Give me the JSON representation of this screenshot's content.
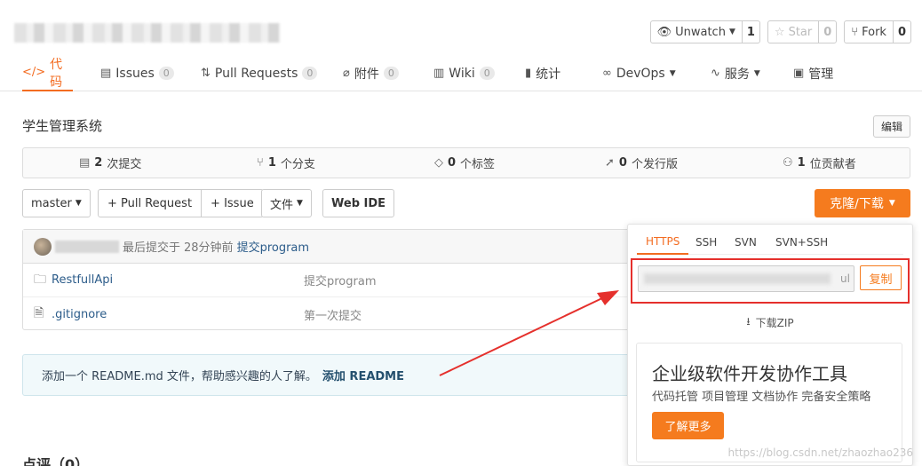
{
  "header": {
    "unwatch_label": "Unwatch",
    "unwatch_count": "1",
    "star_label": "Star",
    "star_count": "0",
    "fork_label": "Fork",
    "fork_count": "0"
  },
  "tabs": [
    {
      "label": "代码",
      "icon": "code-icon"
    },
    {
      "label": "Issues",
      "badge": "0",
      "icon": "issues-icon"
    },
    {
      "label": "Pull Requests",
      "badge": "0",
      "icon": "pull-request-icon"
    },
    {
      "label": "附件",
      "badge": "0",
      "icon": "attachment-icon"
    },
    {
      "label": "Wiki",
      "badge": "0",
      "icon": "wiki-icon"
    },
    {
      "label": "统计",
      "icon": "stats-icon"
    },
    {
      "label": "DevOps",
      "icon": "devops-icon"
    },
    {
      "label": "服务",
      "icon": "service-icon"
    },
    {
      "label": "管理",
      "icon": "manage-icon"
    }
  ],
  "project": {
    "description": "学生管理系统",
    "edit_label": "编辑"
  },
  "stats": {
    "commits_num": "2",
    "commits_label": "次提交",
    "branches_num": "1",
    "branches_label": "个分支",
    "tags_num": "0",
    "tags_label": "个标签",
    "releases_num": "0",
    "releases_label": "个发行版",
    "contributors_num": "1",
    "contributors_label": "位贡献者"
  },
  "toolbar": {
    "branch": "master",
    "pull_request": "+ Pull Request",
    "issue": "+ Issue",
    "file": "文件",
    "web_ide": "Web IDE",
    "clone": "克隆/下载"
  },
  "commit": {
    "prefix": "最后提交于",
    "time": "28分钟前",
    "message": "提交program"
  },
  "files": [
    {
      "name": "RestfullApi",
      "message": "提交program",
      "type": "folder"
    },
    {
      "name": ".gitignore",
      "message": "第一次提交",
      "type": "file"
    }
  ],
  "readme": {
    "text": "添加一个 README.md 文件，帮助感兴趣的人了解。",
    "action": "添加 README"
  },
  "comments_head": "点评（0）",
  "clone_dropdown": {
    "tabs": [
      "HTTPS",
      "SSH",
      "SVN",
      "SVN+SSH"
    ],
    "url_tail": "ul",
    "copy_label": "复制",
    "download_zip": "下载ZIP",
    "promo_title": "企业级软件开发协作工具",
    "promo_subtitle": "代码托管 项目管理 文档协作 完备安全策略",
    "promo_button": "了解更多"
  },
  "watermark": "https://blog.csdn.net/zhaozhao236",
  "colors": {
    "accent": "#f57b1e",
    "annotation": "#e5302c",
    "link": "#2c5c8a"
  }
}
